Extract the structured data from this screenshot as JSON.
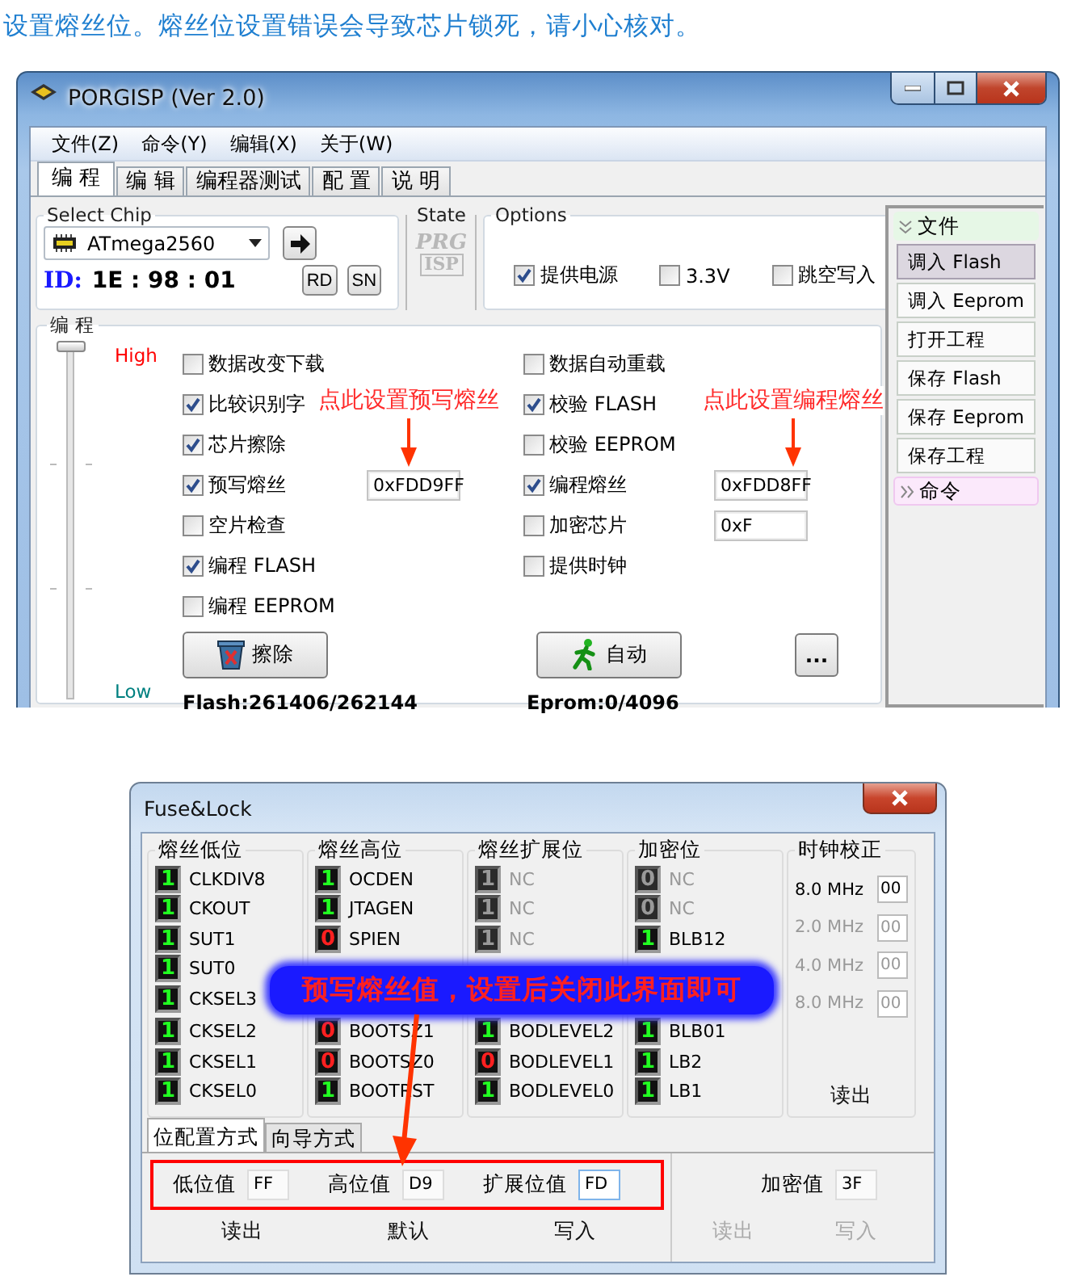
{
  "heading": "设置熔丝位。熔丝位设置错误会导致芯片锁死，请小心核对。",
  "main_window": {
    "title": "PORGISP (Ver 2.0)",
    "menu": [
      "文件(Z)",
      "命令(Y)",
      "编辑(X)",
      "关于(W)"
    ],
    "tabs": [
      {
        "label": "编 程",
        "selected": true
      },
      {
        "label": "编 辑",
        "selected": false
      },
      {
        "label": "编程器测试",
        "selected": false
      },
      {
        "label": "配 置",
        "selected": false
      },
      {
        "label": "说 明",
        "selected": false
      }
    ],
    "select_chip": {
      "title": "Select Chip",
      "chip": "ATmega2560",
      "id_label": "ID:",
      "id_value": "1E : 98 : 01",
      "buttons": [
        "RD",
        "SN"
      ]
    },
    "state": {
      "title": "State",
      "logo": [
        "PRG",
        "ISP"
      ]
    },
    "options": {
      "title": "Options",
      "items": [
        {
          "label": "提供电源",
          "checked": true
        },
        {
          "label": "3.3V",
          "checked": false
        },
        {
          "label": "跳空写入",
          "checked": false
        }
      ]
    },
    "program": {
      "title": "编 程",
      "slider": {
        "high": "High",
        "low": "Low",
        "level": 1
      },
      "left": [
        {
          "label": "数据改变下载",
          "checked": false
        },
        {
          "label": "比较识别字",
          "checked": true
        },
        {
          "label": "芯片擦除",
          "checked": true
        },
        {
          "label": "预写熔丝",
          "checked": true,
          "value": "0xFDD9FF",
          "hint": "点此设置预写熔丝"
        },
        {
          "label": "空片检查",
          "checked": false
        },
        {
          "label": "编程 FLASH",
          "checked": true
        },
        {
          "label": "编程 EEPROM",
          "checked": false
        }
      ],
      "right": [
        {
          "label": "数据自动重载",
          "checked": false
        },
        {
          "label": "校验 FLASH",
          "checked": true
        },
        {
          "label": "校验 EEPROM",
          "checked": false
        },
        {
          "label": "编程熔丝",
          "checked": true,
          "value": "0xFDD8FF",
          "hint": "点此设置编程熔丝"
        },
        {
          "label": "加密芯片",
          "checked": false,
          "value": "0xF"
        },
        {
          "label": "提供时钟",
          "checked": false
        }
      ],
      "buttons": [
        {
          "label": "擦除",
          "kind": "erase"
        },
        {
          "label": "自动",
          "kind": "auto"
        },
        {
          "label": "...",
          "kind": "more"
        }
      ],
      "flash": "Flash:261406/262144",
      "eprom": "Eprom:0/4096"
    },
    "side_panel": [
      {
        "title": "文件",
        "expanded": true,
        "items": [
          {
            "label": "调入 Flash",
            "selected": true
          },
          {
            "label": "调入 Eeprom",
            "selected": false
          },
          {
            "label": "打开工程",
            "selected": false
          },
          {
            "label": "保存 Flash",
            "selected": false
          },
          {
            "label": "保存 Eeprom",
            "selected": false
          },
          {
            "label": "保存工程",
            "selected": false
          }
        ]
      },
      {
        "title": "命令",
        "expanded": false
      }
    ]
  },
  "fuse_window": {
    "title": "Fuse&Lock",
    "groups": [
      {
        "title": "熔丝低位",
        "top_bits": [
          {
            "value": "1",
            "name": "CLKDIV8",
            "enabled": true
          },
          {
            "value": "1",
            "name": "CKOUT",
            "enabled": true
          },
          {
            "value": "1",
            "name": "SUT1",
            "enabled": true
          },
          {
            "value": "1",
            "name": "SUT0",
            "enabled": true
          },
          {
            "value": "1",
            "name": "CKSEL3",
            "enabled": true
          }
        ],
        "bottom_bits": [
          {
            "value": "1",
            "name": "CKSEL2",
            "enabled": true
          },
          {
            "value": "1",
            "name": "CKSEL1",
            "enabled": true
          },
          {
            "value": "1",
            "name": "CKSEL0",
            "enabled": true
          }
        ]
      },
      {
        "title": "熔丝高位",
        "top_bits": [
          {
            "value": "1",
            "name": "OCDEN",
            "enabled": true
          },
          {
            "value": "1",
            "name": "JTAGEN",
            "enabled": true
          },
          {
            "value": "0",
            "name": "SPIEN",
            "enabled": true
          }
        ],
        "bottom_bits": [
          {
            "value": "0",
            "name": "BOOTSZ1",
            "enabled": true
          },
          {
            "value": "0",
            "name": "BOOTSZ0",
            "enabled": true
          },
          {
            "value": "1",
            "name": "BOOTRST",
            "enabled": true
          }
        ]
      },
      {
        "title": "熔丝扩展位",
        "top_bits": [
          {
            "value": "1",
            "name": "NC",
            "enabled": false
          },
          {
            "value": "1",
            "name": "NC",
            "enabled": false
          },
          {
            "value": "1",
            "name": "NC",
            "enabled": false
          }
        ],
        "bottom_bits": [
          {
            "value": "1",
            "name": "BODLEVEL2",
            "enabled": true
          },
          {
            "value": "0",
            "name": "BODLEVEL1",
            "enabled": true
          },
          {
            "value": "1",
            "name": "BODLEVEL0",
            "enabled": true
          }
        ]
      },
      {
        "title": "加密位",
        "top_bits": [
          {
            "value": "0",
            "name": "NC",
            "enabled": false
          },
          {
            "value": "0",
            "name": "NC",
            "enabled": false
          },
          {
            "value": "1",
            "name": "BLB12",
            "enabled": true
          }
        ],
        "bottom_bits": [
          {
            "value": "1",
            "name": "BLB01",
            "enabled": true
          },
          {
            "value": "1",
            "name": "LB2",
            "enabled": true
          },
          {
            "value": "1",
            "name": "LB1",
            "enabled": true
          }
        ]
      }
    ],
    "clock": {
      "title": "时钟校正",
      "rows": [
        {
          "label": "8.0 MHz",
          "value": "00",
          "enabled": true
        },
        {
          "label": "2.0 MHz",
          "value": "00",
          "enabled": false
        },
        {
          "label": "4.0 MHz",
          "value": "00",
          "enabled": false
        },
        {
          "label": "8.0 MHz",
          "value": "00",
          "enabled": false
        }
      ],
      "button": "读出"
    },
    "tabs": [
      {
        "label": "位配置方式",
        "selected": true
      },
      {
        "label": "向导方式",
        "selected": false
      }
    ],
    "fields": [
      {
        "label": "低位值",
        "value": "FF",
        "focused": false
      },
      {
        "label": "高位值",
        "value": "D9",
        "focused": false
      },
      {
        "label": "扩展位值",
        "value": "FD",
        "focused": true
      }
    ],
    "buttons": [
      "读出",
      "默认",
      "写入"
    ],
    "lock": {
      "label": "加密值",
      "value": "3F",
      "buttons": [
        {
          "label": "读出",
          "disabled": true
        },
        {
          "label": "写入",
          "disabled": true
        }
      ]
    },
    "banner": "预写熔丝值，设置后关闭此界面即可"
  }
}
